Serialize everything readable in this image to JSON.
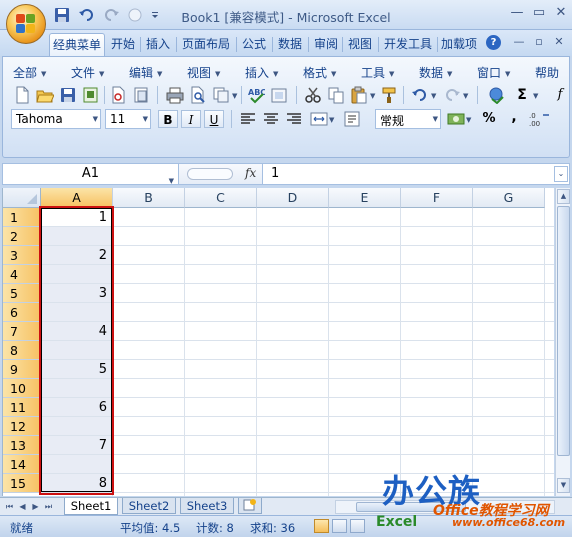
{
  "app": {
    "title": "Book1  [兼容模式] - Microsoft Excel"
  },
  "window_controls": {
    "minimize": "—",
    "maximize": "▭",
    "close": "✕"
  },
  "ribbon_tabs": [
    "经典菜单",
    "开始",
    "插入",
    "页面布局",
    "公式",
    "数据",
    "审阅",
    "视图",
    "开发工具",
    "加载项"
  ],
  "active_tab": "经典菜单",
  "classic_menu": [
    "全部",
    "文件",
    "编辑",
    "视图",
    "插入",
    "格式",
    "工具",
    "数据",
    "窗口",
    "帮助"
  ],
  "toolbar": {
    "font_name": "Tahoma",
    "font_size": "11",
    "bold": "B",
    "italic": "I",
    "underline": "U",
    "number_format": "常规",
    "percent": "%",
    "comma": ",",
    "sigma": "Σ",
    "fx_short": "f"
  },
  "formula_bar": {
    "name_box": "A1",
    "fx_label": "fx",
    "value": "1"
  },
  "grid": {
    "columns": [
      "A",
      "B",
      "C",
      "D",
      "E",
      "F",
      "G"
    ],
    "rows": [
      "1",
      "2",
      "3",
      "4",
      "5",
      "6",
      "7",
      "8",
      "9",
      "10",
      "11",
      "12",
      "13",
      "14",
      "15"
    ],
    "column_a_values": [
      "1",
      "",
      "2",
      "",
      "3",
      "",
      "4",
      "",
      "5",
      "",
      "6",
      "",
      "7",
      "",
      "8"
    ],
    "selected_range": "A1:A15"
  },
  "sheets": [
    "Sheet1",
    "Sheet2",
    "Sheet3"
  ],
  "active_sheet": "Sheet1",
  "status_bar": {
    "mode": "就绪",
    "average": "平均值: 4.5",
    "count": "计数: 8",
    "sum": "求和: 36"
  },
  "watermark": {
    "logo_text": "办公族",
    "site_name": "Office教程学习网",
    "site_url": "www.office68.com",
    "excel_text": "Excel"
  },
  "colors": {
    "selection_border": "#cc1111",
    "header_highlight": "#f7c366",
    "ribbon_text": "#15428b"
  }
}
